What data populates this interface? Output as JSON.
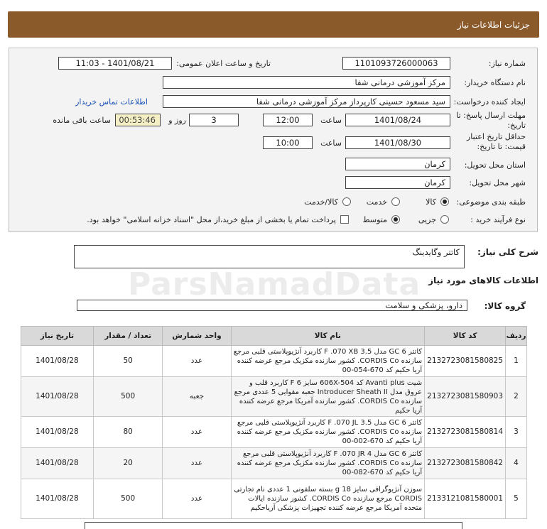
{
  "header": {
    "title": "جزئیات اطلاعات نیاز"
  },
  "form": {
    "need_number": {
      "label": "شماره نیاز:",
      "value": "1101093726000063"
    },
    "announce_datetime": {
      "label": "تاریخ و ساعت اعلان عمومی:",
      "value": "1401/08/21 - 11:03"
    },
    "buyer_org": {
      "label": "نام دستگاه خریدار:",
      "value": "مرکز آموزشی درمانی شفا"
    },
    "requester": {
      "label": "ایجاد کننده درخواست:",
      "value": "سید مسعود حسینی کارپرداز مرکز آموزشی درمانی شفا",
      "contact_link": "اطلاعات تماس خریدار"
    },
    "reply_deadline": {
      "label_line1": "مهلت ارسال پاسخ: تا",
      "label_line2": "تاریخ:",
      "date": "1401/08/24",
      "time_label": "ساعت",
      "time": "12:00",
      "days": "3",
      "days_label": "روز و",
      "remaining": "00:53:46",
      "remaining_label": "ساعت باقی مانده"
    },
    "price_validity": {
      "label_line1": "حداقل تاریخ اعتبار",
      "label_line2": "قیمت: تا تاریخ:",
      "date": "1401/08/30",
      "time_label": "ساعت",
      "time": "10:00"
    },
    "province": {
      "label": "استان محل تحویل:",
      "value": "کرمان"
    },
    "city": {
      "label": "شهر محل تحویل:",
      "value": "کرمان"
    },
    "category": {
      "label": "طبقه بندی موضوعی:",
      "options": [
        "کالا",
        "خدمت",
        "کالا/خدمت"
      ],
      "selected": "کالا"
    },
    "process": {
      "label": "نوع فرآیند خرید :",
      "options": [
        "جزیی",
        "متوسط"
      ],
      "selected": "متوسط",
      "payment_note": "پرداخت تمام یا بخشی از مبلغ خرید،از محل \"اسناد خزانه اسلامی\" خواهد بود."
    }
  },
  "description": {
    "label": "شرح کلی نیاز:",
    "value": "کاتتر وگایدینگ"
  },
  "goods_info": {
    "title": "اطلاعات کالاهای مورد نیاز",
    "group_label": "گروه کالا:",
    "group_value": "دارو، پزشکی و سلامت"
  },
  "watermark": "ParsNamadData",
  "table": {
    "headers": [
      "ردیف",
      "کد کالا",
      "نام کالا",
      "واحد شمارش",
      "تعداد / مقدار",
      "تاریخ نیاز"
    ],
    "rows": [
      {
        "row": "1",
        "code": "2132723081580825",
        "name": "کاتتر 6 GC مدل F .070 XB 3.5 کاربرد آنژیوپلاستی قلبی مرجع سازنده CORDIS Co. کشور سازنده مکزیک مرجع عرضه کننده آریا حکیم کد 670-054-00",
        "unit": "عدد",
        "qty": "50",
        "date": "1401/08/28"
      },
      {
        "row": "2",
        "code": "2132723081580903",
        "name": "شیت Avanti plus کد 606X-504 سایز F 6 کاربرد قلب و عروق مدل Introducer Sheath II جعبه مقوایی 5 عددی مرجع سازنده CORDIS Co. کشور سازنده آمریکا مرجع عرضه کننده آریا حکیم",
        "unit": "جعبه",
        "qty": "500",
        "date": "1401/08/28"
      },
      {
        "row": "3",
        "code": "2132723081580814",
        "name": "کاتتر 6 GC مدل F .070 JL 3.5 کاربرد آنژیوپلاستی قلبی مرجع سازنده CORDIS Co. کشور سازنده مکزیک مرجع عرضه کننده آریا حکیم کد 670-002-00",
        "unit": "عدد",
        "qty": "80",
        "date": "1401/08/28"
      },
      {
        "row": "4",
        "code": "2132723081580842",
        "name": "کاتتر 6 GC مدل F .070 JR 4 کاربرد آنژیوپلاستی قلبی مرجع سازنده CORDIS Co. کشور سازنده مکزیک مرجع عرضه کننده آریا حکیم کد 670-082-00",
        "unit": "عدد",
        "qty": "20",
        "date": "1401/08/28"
      },
      {
        "row": "5",
        "code": "2133121081580001",
        "name": "سوزن آنژیوگرافی سایز 18 g بسته سلفونی 1 عددی نام تجارتی CORDIS مرجع سازنده CORDIS Co. کشور سازنده ایالات متحده آمریکا مرجع عرضه کننده تجهیزات پزشکی آریاحکیم",
        "unit": "عدد",
        "qty": "500",
        "date": "1401/08/28"
      }
    ]
  }
}
